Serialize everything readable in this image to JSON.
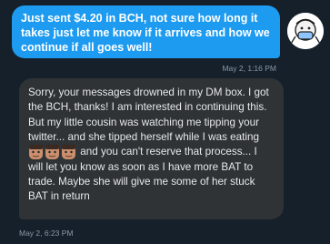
{
  "sent_message": {
    "text": "Just sent $4.20 in BCH, not sure how long it takes just  let me know if it arrives and how we continue if all goes well!",
    "timestamp": "May 2, 1:16 PM"
  },
  "received_message": {
    "text_before": "Sorry, your messages drowned in my DM box. I got the BCH, thanks! I am interested in continuing this. But my little cousin was watching me tipping your twitter... and she tipped herself while I was eating ",
    "emojis": [
      "face-emoji",
      "face-emoji",
      "face-emoji"
    ],
    "text_after": " and you can't reserve that process... I will let you know as soon as I have more BAT to trade. Maybe she will give me some of her stuck BAT in return",
    "timestamp": "May 2, 6:23 PM"
  },
  "colors": {
    "background": "#15202b",
    "sent_bubble": "#1d9bf0",
    "received_bubble": "#2f3336",
    "timestamp": "#8b98a5"
  }
}
